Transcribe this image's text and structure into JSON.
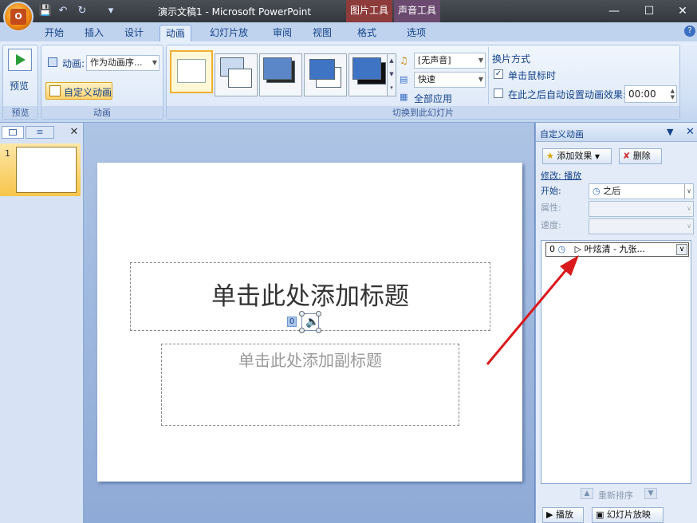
{
  "titlebar": {
    "title": "演示文稿1 - Microsoft PowerPoint",
    "picture_tools": "图片工具",
    "audio_tools": "声音工具"
  },
  "tabs": [
    "开始",
    "插入",
    "设计",
    "动画",
    "幻灯片放映",
    "审阅",
    "视图",
    "格式",
    "选项"
  ],
  "ribbon": {
    "preview_group": {
      "label": "预览",
      "preview_button": "预览"
    },
    "animation_group": {
      "label": "动画",
      "animate_label": "动画:",
      "animate_value": "作为动画序...",
      "custom_animation": "自定义动画"
    },
    "transition_group": {
      "label": "切换到此幻灯片",
      "sound_value": "[无声音]",
      "speed_value": "快速",
      "apply_all": "全部应用"
    },
    "advance_group": {
      "heading": "换片方式",
      "on_click": "单击鼠标时",
      "on_click_checked": true,
      "auto_after": "在此之后自动设置动画效果:",
      "auto_after_checked": false,
      "time_value": "00:00"
    }
  },
  "left_pane": {
    "slide_number": "1"
  },
  "slide": {
    "title_placeholder": "单击此处添加标题",
    "subtitle_placeholder": "单击此处添加副标题",
    "sound_tag": "0"
  },
  "task_pane": {
    "title": "自定义动画",
    "add_effect": "添加效果",
    "remove": "删除",
    "modify_label": "修改: 播放",
    "start_label": "开始:",
    "start_value": "之后",
    "property_label": "属性:",
    "speed_label": "速度:",
    "list_item": {
      "index": "0",
      "name": "叶炫清 - 九张..."
    },
    "reorder": "重新排序",
    "play": "播放",
    "slideshow": "幻灯片放映"
  },
  "annotation": {
    "arrow_color": "#d9191c"
  }
}
